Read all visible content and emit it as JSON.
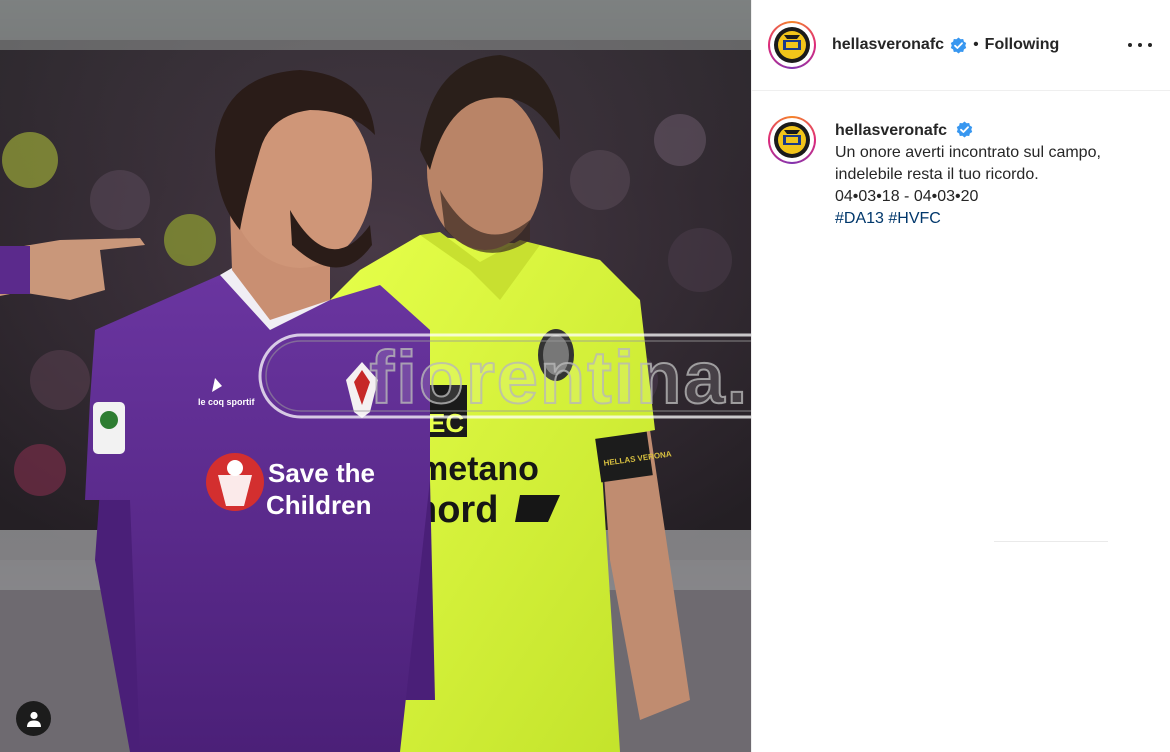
{
  "post": {
    "account": {
      "username": "hellasveronafc",
      "verified": true,
      "follow_status": "Following",
      "separator": "•"
    },
    "caption": {
      "username": "hellasveronafc",
      "lines": [
        "Un onore averti incontrato sul campo,",
        "indelebile resta il tuo ricordo.",
        "04•03•18 - 04•03•20"
      ],
      "hashtags": [
        "#DA13",
        "#HVFC"
      ]
    },
    "photo": {
      "watermark": "fiorentina.it",
      "jersey_left": {
        "sponsor_line1": "Save the",
        "sponsor_line2": "Children",
        "kit_brand": "le coq sportif"
      },
      "jersey_right": {
        "sponsor_partial_1": "EC",
        "sponsor_partial_2": "metano",
        "sponsor_partial_3": "nord",
        "armband": "HELLAS VERONA"
      }
    }
  },
  "colors": {
    "verified_blue": "#3897f0",
    "hashtag_blue": "#00376b",
    "text": "#262626",
    "fiorentina_purple": "#5b2a8c",
    "verona_neon": "#d8f538"
  },
  "icons": {
    "verified": "verified-badge-icon",
    "more": "more-options-icon",
    "tag": "user-tag-icon",
    "avatar": "hellas-verona-crest-icon"
  }
}
